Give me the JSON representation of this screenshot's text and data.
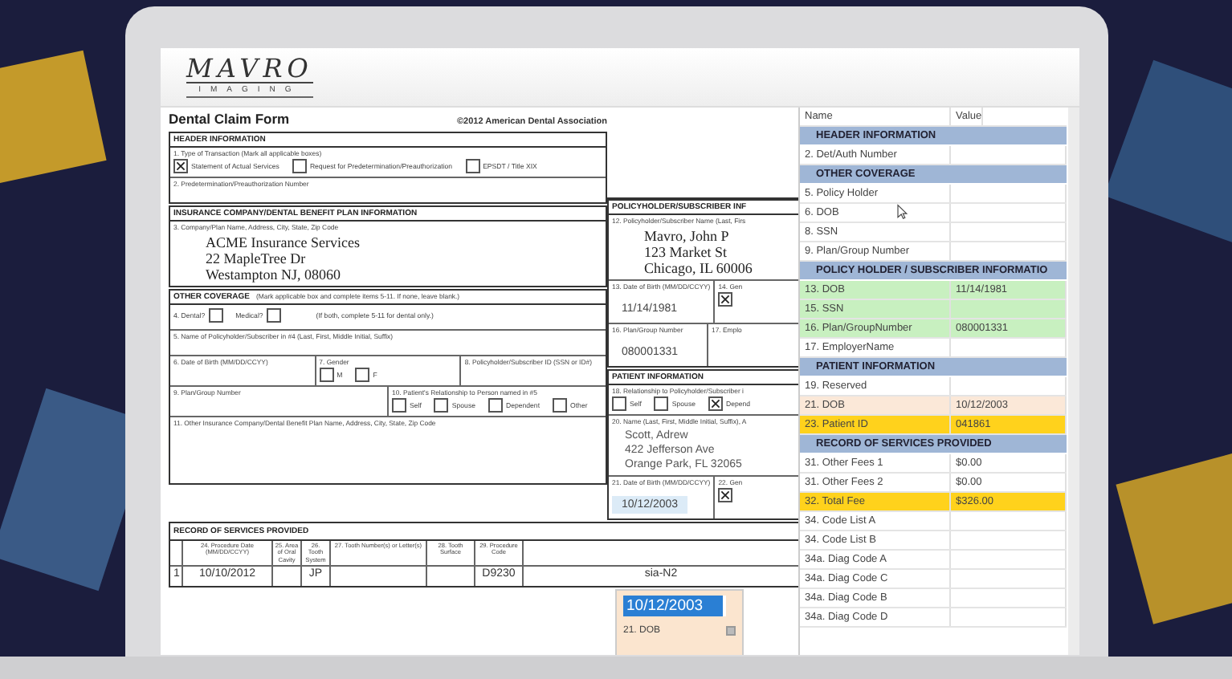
{
  "logo": {
    "name": "MAVRO",
    "tagline": "IMAGING"
  },
  "form": {
    "title": "Dental Claim Form",
    "copyright": "©2012 American Dental Association",
    "left_sections": [
      {
        "title": "HEADER INFORMATION",
        "rows": [
          {
            "fields": [
              {
                "kind": "choices",
                "label": "1. Type of Transaction (Mark all applicable boxes)",
                "options": [
                  {
                    "label": "Statement of Actual Services",
                    "checked": true
                  },
                  {
                    "label": "Request for Predetermination/Preauthorization",
                    "checked": false
                  },
                  {
                    "label": "EPSDT / Title XIX",
                    "checked": false
                  }
                ]
              }
            ]
          },
          {
            "fields": [
              {
                "kind": "text",
                "label": "2. Predetermination/Preauthorization Number"
              }
            ]
          }
        ]
      },
      {
        "title": "INSURANCE COMPANY/DENTAL BENEFIT PLAN INFORMATION",
        "rows": [
          {
            "fields": [
              {
                "kind": "text",
                "label": "3. Company/Plan Name, Address, City, State, Zip Code",
                "lines": [
                  "ACME Insurance Services",
                  "22 MapleTree Dr",
                  "Westampton NJ, 08060"
                ]
              }
            ]
          }
        ]
      },
      {
        "title": "OTHER COVERAGE",
        "note": "(Mark applicable box and complete items 5-11. If none, leave blank.)",
        "rows": [
          {
            "fields": [
              {
                "kind": "inline",
                "options": [
                  {
                    "label": "4. Dental?",
                    "checked": false
                  },
                  {
                    "label": "Medical?",
                    "checked": false
                  }
                ],
                "note": "(If both, complete 5-11 for dental only.)"
              }
            ]
          },
          {
            "fields": [
              {
                "kind": "text",
                "label": "5. Name of Policyholder/Subscriber in #4 (Last, First, Middle Initial, Suffix)"
              }
            ]
          },
          {
            "fields": [
              {
                "kind": "text",
                "label": "6. Date of Birth (MM/DD/CCYY)"
              },
              {
                "kind": "choices",
                "label": "7. Gender",
                "options": [
                  {
                    "label": "M",
                    "checked": false
                  },
                  {
                    "label": "F",
                    "checked": false
                  }
                ]
              },
              {
                "kind": "text",
                "label": "8. Policyholder/Subscriber ID (SSN or ID#)"
              }
            ]
          },
          {
            "fields": [
              {
                "kind": "text",
                "label": "9. Plan/Group Number"
              },
              {
                "kind": "choices",
                "label": "10. Patient's Relationship to Person named in #5",
                "options": [
                  {
                    "label": "Self",
                    "checked": false
                  },
                  {
                    "label": "Spouse",
                    "checked": false
                  },
                  {
                    "label": "Dependent",
                    "checked": false
                  },
                  {
                    "label": "Other",
                    "checked": false
                  }
                ]
              }
            ]
          },
          {
            "fields": [
              {
                "kind": "area",
                "label": "11. Other Insurance Company/Dental Benefit Plan Name, Address, City, State, Zip Code"
              }
            ]
          }
        ]
      }
    ],
    "right_sections": [
      {
        "title": "POLICYHOLDER/SUBSCRIBER INF",
        "rows": [
          {
            "fields": [
              {
                "kind": "text",
                "label": "12. Policyholder/Subscriber Name (Last, Firs",
                "lines": [
                  "Mavro, John P",
                  "123 Market St",
                  "Chicago, IL 60006"
                ]
              }
            ]
          },
          {
            "fields": [
              {
                "kind": "text",
                "label": "13. Date of Birth (MM/DD/CCYY)",
                "value": "11/14/1981",
                "highlighted": false
              },
              {
                "kind": "choices",
                "label": "14. Gen",
                "options": [
                  {
                    "checked": true
                  }
                ]
              }
            ]
          },
          {
            "fields": [
              {
                "kind": "text",
                "label": "16. Plan/Group Number",
                "value": "080001331",
                "highlighted": false
              },
              {
                "kind": "text",
                "label": "17. Emplo"
              }
            ]
          }
        ]
      },
      {
        "title": "PATIENT INFORMATION",
        "rows": [
          {
            "fields": [
              {
                "kind": "choices",
                "label": "18. Relationship to Policyholder/Subscriber i",
                "options": [
                  {
                    "label": "Self",
                    "checked": false
                  },
                  {
                    "label": "Spouse",
                    "checked": false
                  },
                  {
                    "label": "Depend",
                    "checked": true
                  }
                ]
              }
            ]
          },
          {
            "fields": [
              {
                "kind": "typed",
                "label": "20. Name (Last, First, Middle Initial, Suffix), A",
                "lines": [
                  "Scott, Adrew",
                  "422 Jefferson Ave",
                  "Orange Park, FL 32065"
                ]
              }
            ]
          },
          {
            "fields": [
              {
                "kind": "text",
                "label": "21. Date of Birth (MM/DD/CCYY)",
                "value": "10/12/2003",
                "highlighted": true
              },
              {
                "kind": "choices",
                "label": "22. Gen",
                "options": [
                  {
                    "checked": true
                  }
                ]
              }
            ]
          }
        ]
      }
    ],
    "services": {
      "title": "RECORD OF SERVICES PROVIDED",
      "columns": [
        "24. Procedure Date (MM/DD/CCYY)",
        "25. Area of Oral Cavity",
        "26. Tooth System",
        "27. Tooth Number(s) or Letter(s)",
        "28. Tooth Surface",
        "29. Procedure Code"
      ],
      "rows": [
        {
          "number": "1",
          "date": "10/10/2012",
          "system": "JP",
          "code": "D9230",
          "description": "sia-N2"
        }
      ]
    },
    "editor": {
      "value": "10/12/2003",
      "label": "21. DOB"
    }
  },
  "grid": {
    "columns": [
      "Name",
      "Value"
    ],
    "rows": [
      {
        "kind": "section",
        "name": "HEADER INFORMATION"
      },
      {
        "kind": "row",
        "name": "2. Det/Auth Number"
      },
      {
        "kind": "section",
        "name": "OTHER COVERAGE"
      },
      {
        "kind": "row",
        "name": "5. Policy Holder"
      },
      {
        "kind": "row",
        "name": "6. DOB"
      },
      {
        "kind": "row",
        "name": "8. SSN"
      },
      {
        "kind": "row",
        "name": "9. Plan/Group Number"
      },
      {
        "kind": "section",
        "name": "POLICY HOLDER / SUBSCRIBER INFORMATIO"
      },
      {
        "kind": "row",
        "name": "13. DOB",
        "value": "11/14/1981",
        "color": "#c8f0c0"
      },
      {
        "kind": "row",
        "name": "15. SSN",
        "color": "#c8f0c0"
      },
      {
        "kind": "row",
        "name": "16. Plan/GroupNumber",
        "value": "080001331",
        "color": "#c8f0c0"
      },
      {
        "kind": "row",
        "name": "17. EmployerName"
      },
      {
        "kind": "section",
        "name": "PATIENT INFORMATION"
      },
      {
        "kind": "row",
        "name": "19. Reserved"
      },
      {
        "kind": "row",
        "name": "21. DOB",
        "value": "10/12/2003",
        "color": "#fbe8d8"
      },
      {
        "kind": "row",
        "name": "23. Patient ID",
        "value": "041861",
        "color": "#ffd21c"
      },
      {
        "kind": "section",
        "name": "RECORD OF SERVICES PROVIDED"
      },
      {
        "kind": "row",
        "name": "31. Other Fees 1",
        "value": "$0.00"
      },
      {
        "kind": "row",
        "name": "31. Other Fees 2",
        "value": "$0.00"
      },
      {
        "kind": "row",
        "name": "32. Total Fee",
        "value": "$326.00",
        "color": "#ffd21c"
      },
      {
        "kind": "row",
        "name": "34. Code List A"
      },
      {
        "kind": "row",
        "name": "34. Code List B"
      },
      {
        "kind": "row",
        "name": "34a. Diag Code A"
      },
      {
        "kind": "row",
        "name": "34a. Diag Code C"
      },
      {
        "kind": "row",
        "name": "34a. Diag Code B"
      },
      {
        "kind": "row",
        "name": "34a. Diag Code D"
      }
    ]
  }
}
